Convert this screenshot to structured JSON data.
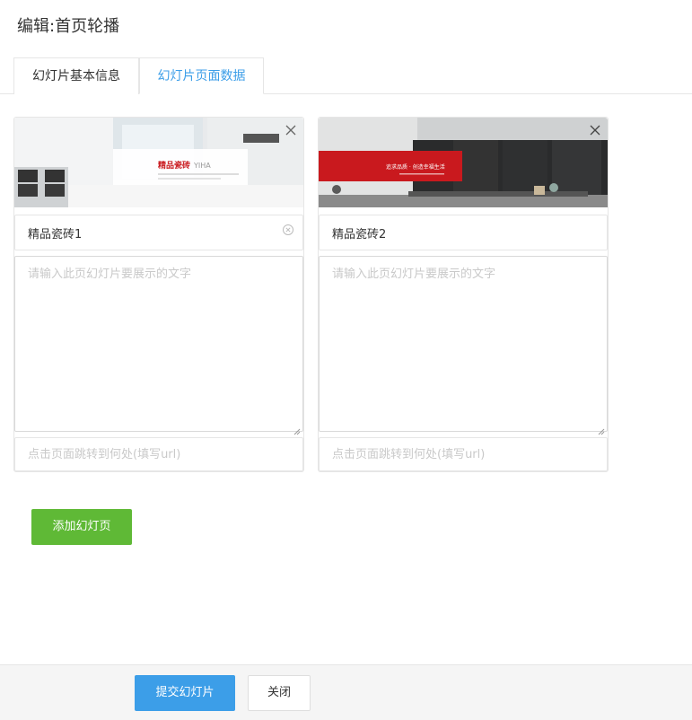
{
  "page_title": "编辑:首页轮播",
  "tabs": [
    {
      "label": "幻灯片基本信息",
      "active": false
    },
    {
      "label": "幻灯片页面数据",
      "active": true
    }
  ],
  "slides": [
    {
      "title_value": "精品瓷砖1",
      "text_placeholder": "请输入此页幻灯片要展示的文字",
      "url_placeholder": "点击页面跳转到何处(填写url)",
      "banner_headline": "精品瓷砖",
      "banner_headline_suffix": "YIHA"
    },
    {
      "title_value": "精品瓷砖2",
      "text_placeholder": "请输入此页幻灯片要展示的文字",
      "url_placeholder": "点击页面跳转到何处(填写url)",
      "banner_headline": "追求品质 · 创造幸福生活"
    }
  ],
  "buttons": {
    "add_slide": "添加幻灯页",
    "submit": "提交幻灯片",
    "close": "关闭"
  },
  "colors": {
    "tab_active": "#3c9ee8",
    "add_button": "#5fb936",
    "submit_button": "#3c9ee8",
    "banner_red": "#c9191e"
  }
}
